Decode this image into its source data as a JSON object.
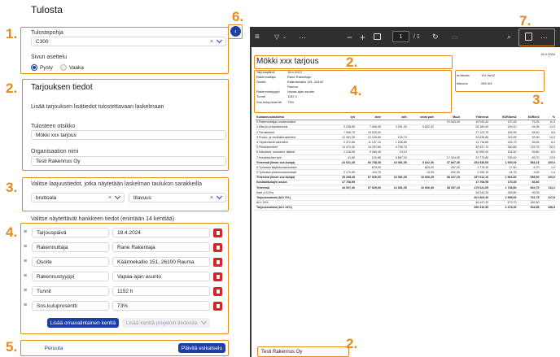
{
  "page_title": "Tulosta",
  "annotations": [
    "1.",
    "2.",
    "3.",
    "4.",
    "5.",
    "6.",
    "7.",
    "2.",
    "4.",
    "3.",
    "2."
  ],
  "template": {
    "label": "Tulostepohja",
    "value": "C300"
  },
  "orientation": {
    "label": "Sivun asettelu",
    "options": [
      "Pysty",
      "Vaaka"
    ]
  },
  "offer_info": {
    "heading": "Tarjouksen tiedot",
    "description": "Lisää tarjouksen lisätiedot tulostettavaan laskelmaan",
    "title_label": "Tulosteen otsikko",
    "title_value": "Mökki xxx tarjous",
    "org_label": "Organisaation nimi",
    "org_value": "Testi Rakennus Oy"
  },
  "quantity_columns": {
    "label": "Valitse laajuustiedot, jotka näytetään laskelman taulukon sarakkeilla",
    "first": "bruttoala",
    "second": "tilavuus"
  },
  "project_fields": {
    "label": "Valitse näytettävät hankkeen tiedot (enintään 14 kenttää)",
    "rows": [
      {
        "name": "Tarjouspäivä",
        "value": "18.4.2024"
      },
      {
        "name": "Rakennuttaja",
        "value": "Rane Rakentaja"
      },
      {
        "name": "Osoite",
        "value": "Käärmekallio 151, 26100 Rauma"
      },
      {
        "name": "Rakennustyyppi",
        "value": "Vapaa-ajan asunto"
      },
      {
        "name": "Tunnit",
        "value": "1152 h"
      },
      {
        "name": "Sos.kuluprosentti",
        "value": "73%"
      }
    ],
    "add_custom_label": "Lisää omavalintainen kenttä",
    "add_from_project_label": "Lisää kenttä projektin tiedoista"
  },
  "actions": {
    "cancel": "Peruuta",
    "update": "Päivitä esikatselu"
  },
  "viewer": {
    "page_current": "1",
    "page_total": "/ 1"
  },
  "preview": {
    "date": "18.4.2024",
    "title": "Mökki xxx tarjous",
    "info": [
      [
        "Tarjouspäivä",
        "18.4.2024"
      ],
      [
        "Rakennuttaja",
        "Rane Rakentaja"
      ],
      [
        "Osoite",
        "Käärmekallio 151, 26100 Rauma"
      ],
      [
        "Rakennustyyppi",
        "Vapaa-ajan asunto"
      ],
      [
        "Tunnit",
        "1152 h"
      ],
      [
        "Sos.kuluprosentti",
        "73%"
      ]
    ],
    "quantities": [
      [
        "bruttoala",
        "101 brm2"
      ],
      [
        "tilavuus",
        "265 m3"
      ]
    ],
    "table_head": [
      "Kustannuslaskelma",
      "työ",
      "aine",
      "alih",
      "omat palv",
      "Muut",
      "Yhteensä",
      "EUR/brm2",
      "EUR/m3",
      "%"
    ],
    "table_rows": [
      {
        "b": false,
        "c": [
          "0 Rakennuttajan kustannukset",
          "",
          "",
          "",
          "",
          "19 943,40",
          "19 943,40",
          "197,45",
          "75,25",
          "11,4"
        ]
      },
      {
        "b": false,
        "c": [
          "1 Maa ja pohjarakennus",
          "3 238,65",
          "7 848,45",
          "4 251,20",
          "9 822,32",
          "",
          "25 160,60",
          "249,10",
          "94,95",
          "14,3"
        ]
      },
      {
        "b": false,
        "c": [
          "2 Perustukset",
          "7 098,70",
          "10 025,00",
          "",
          "",
          "",
          "17 123,75",
          "169,55",
          "64,60",
          "9,8"
        ]
      },
      {
        "b": false,
        "c": [
          "3 Runko- ja vesikattorakenteet",
          "12 991,30",
          "12 109,85",
          "135,70",
          "",
          "",
          "24 636,85",
          "243,95",
          "92,95",
          "14,0"
        ]
      },
      {
        "b": false,
        "c": [
          "4 Täydentävät rakenteet",
          "2 372,65",
          "11 137,10",
          "1 206,85",
          "",
          "",
          "14 716,65",
          "145,70",
          "55,55",
          "8,4"
        ]
      },
      {
        "b": false,
        "c": [
          "5 Pintarakenteet",
          "14 474,30",
          "16 207,65",
          "4 755,75",
          "",
          "",
          "35 437,70",
          "350,85",
          "133,75",
          "20,2"
        ]
      },
      {
        "b": false,
        "c": [
          "6 Kalusteet, varusteet, laitteet",
          "1 218,95",
          "9 289,45",
          "24,10",
          "",
          "",
          "10 552,90",
          "104,50",
          "39,80",
          "6,0"
        ]
      },
      {
        "b": false,
        "c": [
          "7 Konetekniset työt",
          "41,80",
          "120,85",
          "5 687,10",
          "",
          "17 924,05",
          "23 773,80",
          "235,40",
          "89,70",
          "13,5"
        ]
      },
      {
        "b": true,
        "c": [
          "Yhteensä (ilman sos.kuluja)",
          "24 021,45",
          "66 738,35",
          "16 081,05",
          "9 822,30",
          "37 867,45",
          "154 530,65",
          "1 530,00",
          "583,15",
          "100,0"
        ]
      },
      {
        "b": false,
        "c": [
          "8 Työmaan käyttökustannukset",
          "",
          "679,90",
          "",
          "829,20",
          "267,20",
          "1 776,30",
          "17,60",
          "6,70",
          "1,0"
        ]
      },
      {
        "b": false,
        "c": [
          "9 Työmaan yhteiskustannukset",
          "2 170,55",
          "110,75",
          "",
          "14,95",
          "202,50",
          "2 499,15",
          "24,75",
          "9,45",
          "1,4"
        ]
      },
      {
        "b": true,
        "c": [
          "Yhteensä (ilman sos.kuluja)",
          "25 298,45",
          "67 529,00",
          "16 081,05",
          "10 666,45",
          "38 337,15",
          "157 912,10",
          "1 563,50",
          "595,90",
          "100,0"
        ]
      },
      {
        "b": true,
        "c": [
          "Sosiaalikulujen osuus",
          "17 708,95",
          "",
          "",
          "",
          "",
          "17 708,95",
          "175,35",
          "66,80",
          ""
        ]
      },
      {
        "b": true,
        "c": [
          "Yhteensä",
          "43 007,40",
          "67 529,00",
          "16 081,05",
          "10 666,45",
          "38 337,15",
          "175 621,05",
          "1 738,80",
          "662,70",
          "111,2"
        ]
      },
      {
        "b": false,
        "c": [
          "Kate (13,0%)",
          "",
          "",
          "",
          "",
          "",
          "26 242,25",
          "259,80",
          "99,05",
          ""
        ]
      },
      {
        "b": true,
        "c": [
          "Tarjoussumma (ALV 0%)",
          "",
          "",
          "",
          "",
          "",
          "201 863,30",
          "1 998,65",
          "761,75",
          "127,8"
        ]
      },
      {
        "b": false,
        "c": [
          "ALV 24%",
          "",
          "",
          "",
          "",
          "",
          "48 447,20",
          "479,70",
          "182,80",
          ""
        ]
      },
      {
        "b": true,
        "c": [
          "Tarjoussumma (ALV 24%)",
          "",
          "",
          "",
          "",
          "",
          "250 310,50",
          "2 478,30",
          "944,55",
          "158,5"
        ]
      }
    ],
    "footer_org": "Testi Rakennus Oy"
  },
  "colors": {
    "accent": "#1e3ea6",
    "annotation": "#e58a1f",
    "danger": "#d8212a",
    "viewer_bg": "#3a3a3a"
  },
  "icons": [
    "hamburger-icon",
    "filter-icon",
    "more-icon",
    "zoom-out-icon",
    "zoom-in-icon",
    "fit-page-icon",
    "rotate-icon",
    "search-icon",
    "save-icon",
    "chevron-left-icon",
    "trash-icon",
    "drag-handle-icon"
  ]
}
